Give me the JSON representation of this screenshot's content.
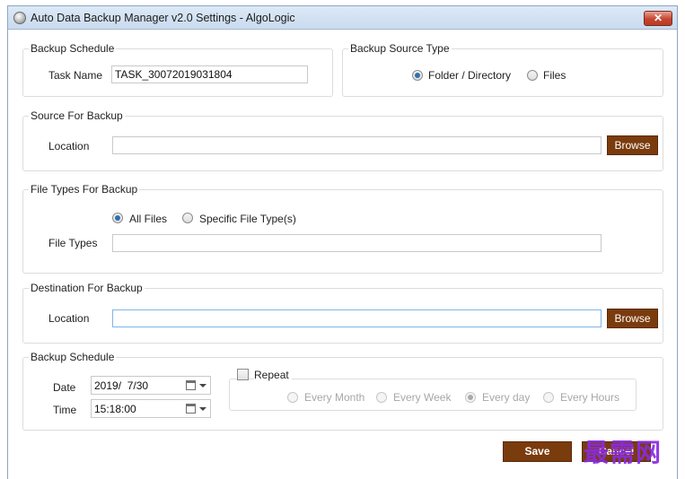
{
  "window": {
    "title": "Auto Data Backup Manager v2.0 Settings - AlgoLogic",
    "close_glyph": "✕"
  },
  "backup_schedule_top": {
    "title": "Backup Schedule",
    "task_name_label": "Task Name",
    "task_name_value": "TASK_30072019031804"
  },
  "backup_source_type": {
    "title": "Backup Source Type",
    "options": [
      {
        "label": "Folder / Directory",
        "selected": true
      },
      {
        "label": "Files",
        "selected": false
      }
    ]
  },
  "source": {
    "title": "Source For Backup",
    "location_label": "Location",
    "location_value": "",
    "browse_label": "Browse"
  },
  "file_types": {
    "title": "File Types For Backup",
    "options": [
      {
        "label": "All Files",
        "selected": true
      },
      {
        "label": "Specific File Type(s)",
        "selected": false
      }
    ],
    "file_types_label": "File Types",
    "file_types_value": ""
  },
  "destination": {
    "title": "Destination For Backup",
    "location_label": "Location",
    "location_value": "",
    "browse_label": "Browse"
  },
  "schedule": {
    "title": "Backup Schedule",
    "date_label": "Date",
    "date_value": "2019/  7/30",
    "time_label": "Time",
    "time_value": "15:18:00",
    "repeat_label": "Repeat",
    "repeat_checked": false,
    "repeat_options": [
      {
        "label": "Every Month",
        "selected": false
      },
      {
        "label": "Every Week",
        "selected": false
      },
      {
        "label": "Every day",
        "selected": true
      },
      {
        "label": "Every Hours",
        "selected": false
      }
    ]
  },
  "footer": {
    "save_label": "Save",
    "cancel_label": "Cancel"
  },
  "watermark": "最需网",
  "colors": {
    "button_bg": "#7a3b0d",
    "radio_dot": "#2f6fb0",
    "watermark": "#8a2be2"
  }
}
